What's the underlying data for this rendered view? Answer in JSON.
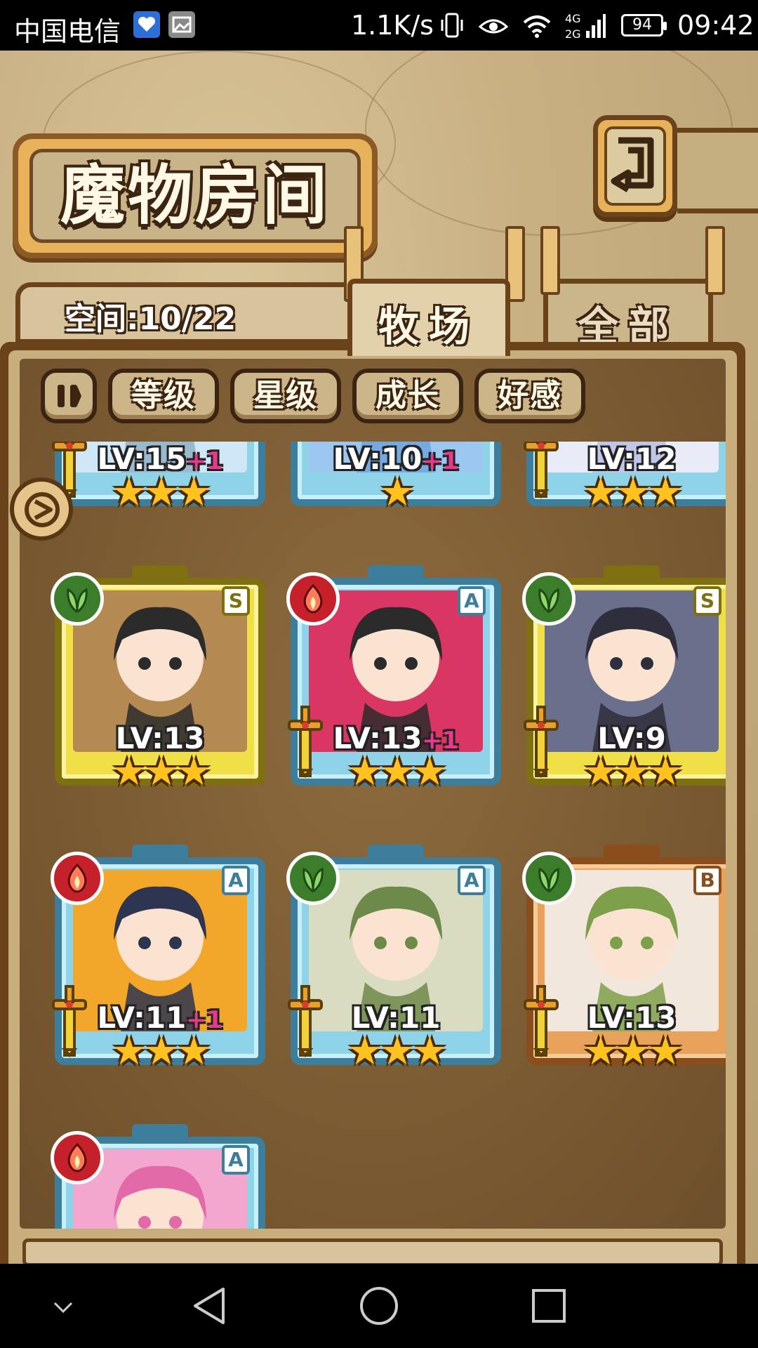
{
  "status_bar": {
    "carrier": "中国电信",
    "speed": "1.1K/s",
    "signal_label": "4G 2G",
    "battery": "94",
    "time": "09:42"
  },
  "screen": {
    "title": "魔物房间",
    "capacity": "空间:10/22",
    "tabs": [
      {
        "label": "牧场",
        "active": true
      },
      {
        "label": "全部",
        "active": false
      }
    ],
    "filters": [
      "等级",
      "星级",
      "成长",
      "好感"
    ]
  },
  "monsters": [
    {
      "level": "LV:15",
      "bonus": "+1",
      "stars": "★★★",
      "rank": "",
      "element": "",
      "frame": "blue",
      "weapon": true,
      "palette": [
        "#cfe7f7",
        "#8fb0c8"
      ]
    },
    {
      "level": "LV:10",
      "bonus": "+1",
      "stars": "★",
      "rank": "",
      "element": "",
      "frame": "blue",
      "weapon": false,
      "palette": [
        "#9cc7f1",
        "#6ea3de"
      ]
    },
    {
      "level": "LV:12",
      "bonus": "",
      "stars": "★★★",
      "rank": "",
      "element": "",
      "frame": "blue",
      "weapon": true,
      "palette": [
        "#e9ecf8",
        "#b7bfe6"
      ]
    },
    {
      "level": "LV:13",
      "bonus": "",
      "stars": "★★★",
      "rank": "S",
      "element": "grass",
      "frame": "gold",
      "weapon": false,
      "palette": [
        "#b48a52",
        "#2b2b2b"
      ]
    },
    {
      "level": "LV:13",
      "bonus": "+1",
      "stars": "★★★",
      "rank": "A",
      "element": "fire",
      "frame": "blue",
      "weapon": true,
      "palette": [
        "#d93663",
        "#2b2b2b"
      ]
    },
    {
      "level": "LV:9",
      "bonus": "",
      "stars": "★★★",
      "rank": "S",
      "element": "grass",
      "frame": "gold",
      "weapon": true,
      "palette": [
        "#6a6f8c",
        "#2e2e3c"
      ]
    },
    {
      "level": "LV:11",
      "bonus": "+1",
      "stars": "★★★",
      "rank": "A",
      "element": "fire",
      "frame": "blue",
      "weapon": true,
      "palette": [
        "#f2a72a",
        "#2e3550"
      ]
    },
    {
      "level": "LV:11",
      "bonus": "",
      "stars": "★★★",
      "rank": "A",
      "element": "grass",
      "frame": "blue",
      "weapon": true,
      "palette": [
        "#d9dcc0",
        "#6d8a4a"
      ]
    },
    {
      "level": "LV:13",
      "bonus": "",
      "stars": "★★★",
      "rank": "B",
      "element": "grass",
      "frame": "orange",
      "weapon": true,
      "palette": [
        "#f1e7dc",
        "#7fa04a"
      ]
    },
    {
      "level": "",
      "bonus": "",
      "stars": "",
      "rank": "A",
      "element": "fire",
      "frame": "blue",
      "weapon": false,
      "palette": [
        "#f3a7cf",
        "#e36aa9"
      ]
    }
  ],
  "colors": {
    "frame_blue": "#8fd3e8",
    "frame_gold": "#f1df47",
    "frame_orange": "#e9a25c",
    "level_bonus": "#e8398b",
    "star": "#ffc21e"
  },
  "icons": [
    "back-arrow-icon",
    "pause-icon",
    "grass-element-icon",
    "fire-element-icon",
    "sword-icon",
    "float-arrow-icon"
  ]
}
